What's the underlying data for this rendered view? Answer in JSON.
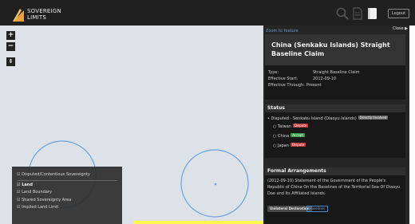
{
  "app": {
    "brand_line1": "SOVEREIGN",
    "brand_line2": "LIMITS",
    "brand_color": "#e8a33a",
    "icons": [
      "search-icon",
      "document-icon",
      "book-icon"
    ],
    "logout_label": "Logout"
  },
  "map": {
    "zoom_in": "+",
    "zoom_out": "−",
    "reset": "⇕",
    "boundary_color": "#6aa2dc",
    "legend": [
      {
        "label": "☑ Disputed/Contentious Sovereignty",
        "bold": false
      },
      {
        "label": "☑ Land",
        "bold": true
      },
      {
        "label": "☑ Land Boundary",
        "bold": false
      },
      {
        "label": "☑ Shared Sovereignty Area",
        "bold": false
      },
      {
        "label": "☑ Implied Land Limit",
        "bold": false
      }
    ]
  },
  "panel": {
    "zoom_link": "Zoom to feature",
    "close_label": "Close ▶",
    "title": "China (Senkaku Islands) Straight Baseline Claim",
    "meta": [
      {
        "label": "Type:",
        "value": "Straight Baseline Claim"
      },
      {
        "label": "Effective Start:",
        "value": "2012-09-10"
      },
      {
        "label": "Effective Through:",
        "value": "Present"
      }
    ],
    "status": {
      "heading": "Status",
      "summary": "Disputed - Senkaku Island (Diaoyu Islands)",
      "summary_badge": "Directly Involved",
      "parties": [
        {
          "name": "Taiwan",
          "badge": "Dispute"
        },
        {
          "name": "China",
          "badge": "Accept"
        },
        {
          "name": "Japan",
          "badge": "Dispute"
        }
      ]
    },
    "formal": {
      "heading": "Formal Arrangements",
      "text": "(2012-09-10) Statement of the Government of the People's Republic of China On the Baselines of the Territorial Sea Of Diaoyu Dao and Its Affiliated Islands",
      "tags": [
        "Unilateral Declaration",
        "Baselines"
      ]
    }
  }
}
